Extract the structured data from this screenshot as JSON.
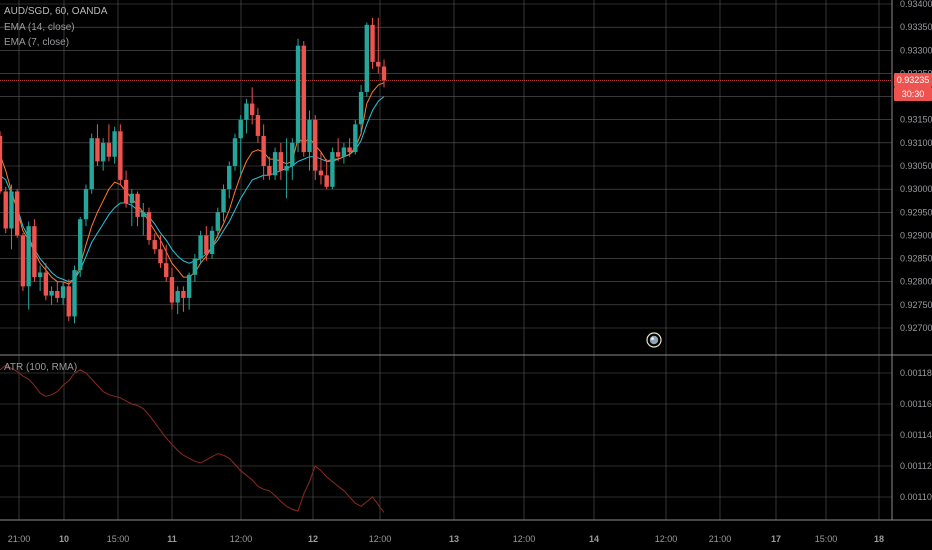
{
  "header": {
    "symbol_line": "AUD/SGD, 60, OANDA",
    "ema14_label": "EMA (14, close)",
    "ema7_label": "EMA (7, close)",
    "atr_label": "ATR (100, RMA)"
  },
  "price_tags": {
    "last_price": "0.93235",
    "countdown": "30:30",
    "last_price_color": "#ef5350"
  },
  "colors": {
    "background": "#000000",
    "grid": "#5a5a5a",
    "up_candle": "#26a69a",
    "down_candle": "#ef5350",
    "ema14": "#26c6da",
    "ema7": "#ff7b2e",
    "atr": "#8b2a20"
  },
  "chart_data": [
    {
      "type": "candlestick",
      "title": "AUD/SGD, 60, OANDA",
      "ylim": [
        0.92665,
        0.93405
      ],
      "y_ticks": [
        "0.93400",
        "0.93350",
        "0.93300",
        "0.93250",
        "0.93200",
        "0.93150",
        "0.93100",
        "0.93050",
        "0.93000",
        "0.92950",
        "0.92900",
        "0.92850",
        "0.92800",
        "0.92750",
        "0.92700"
      ],
      "x_ticks": [
        "21:00",
        "10",
        "15:00",
        "11",
        "12:00",
        "12",
        "12:00",
        "13",
        "12:00",
        "14",
        "12:00",
        "21:00",
        "17",
        "15:00",
        "18"
      ],
      "candles": [
        [
          0.93115,
          0.93125,
          0.9299,
          0.92995
        ],
        [
          0.92995,
          0.93005,
          0.92905,
          0.92915
        ],
        [
          0.92915,
          0.9301,
          0.9287,
          0.92995
        ],
        [
          0.92995,
          0.93,
          0.92895,
          0.929
        ],
        [
          0.929,
          0.92905,
          0.9278,
          0.9279
        ],
        [
          0.9279,
          0.9293,
          0.9274,
          0.9292
        ],
        [
          0.9292,
          0.92935,
          0.928,
          0.9281
        ],
        [
          0.9281,
          0.92835,
          0.9278,
          0.9282
        ],
        [
          0.9282,
          0.9284,
          0.9276,
          0.9277
        ],
        [
          0.9277,
          0.9279,
          0.9275,
          0.9278
        ],
        [
          0.9278,
          0.928,
          0.92755,
          0.92765
        ],
        [
          0.92765,
          0.928,
          0.9275,
          0.9279
        ],
        [
          0.9279,
          0.92805,
          0.92715,
          0.92725
        ],
        [
          0.92725,
          0.92835,
          0.9271,
          0.92825
        ],
        [
          0.92825,
          0.9294,
          0.9281,
          0.92935
        ],
        [
          0.92935,
          0.9301,
          0.9292,
          0.93
        ],
        [
          0.93,
          0.9312,
          0.9299,
          0.9311
        ],
        [
          0.9311,
          0.9314,
          0.9305,
          0.9306
        ],
        [
          0.9306,
          0.9311,
          0.9304,
          0.931
        ],
        [
          0.931,
          0.9314,
          0.9306,
          0.9307
        ],
        [
          0.9307,
          0.93135,
          0.93055,
          0.93125
        ],
        [
          0.93125,
          0.9314,
          0.9301,
          0.9302
        ],
        [
          0.9302,
          0.9304,
          0.9296,
          0.9297
        ],
        [
          0.9297,
          0.93,
          0.9292,
          0.9299
        ],
        [
          0.9299,
          0.92995,
          0.9292,
          0.9294
        ],
        [
          0.9294,
          0.9297,
          0.929,
          0.9295
        ],
        [
          0.9295,
          0.9296,
          0.9288,
          0.9289
        ],
        [
          0.9289,
          0.92905,
          0.9286,
          0.9287
        ],
        [
          0.9287,
          0.929,
          0.9283,
          0.9284
        ],
        [
          0.9284,
          0.9288,
          0.928,
          0.9281
        ],
        [
          0.9281,
          0.9283,
          0.9274,
          0.92755
        ],
        [
          0.92755,
          0.9279,
          0.9273,
          0.9278
        ],
        [
          0.9278,
          0.9279,
          0.92735,
          0.92765
        ],
        [
          0.92765,
          0.9282,
          0.9274,
          0.92815
        ],
        [
          0.92815,
          0.9286,
          0.928,
          0.9285
        ],
        [
          0.9285,
          0.9291,
          0.9284,
          0.929
        ],
        [
          0.929,
          0.9292,
          0.92845,
          0.9286
        ],
        [
          0.9286,
          0.9292,
          0.9285,
          0.9291
        ],
        [
          0.9291,
          0.9296,
          0.92895,
          0.9295
        ],
        [
          0.9295,
          0.9301,
          0.9293,
          0.93
        ],
        [
          0.93,
          0.9306,
          0.9298,
          0.9305
        ],
        [
          0.9305,
          0.9312,
          0.9304,
          0.9311
        ],
        [
          0.9311,
          0.9316,
          0.9303,
          0.9315
        ],
        [
          0.9315,
          0.93195,
          0.9312,
          0.93185
        ],
        [
          0.93185,
          0.9322,
          0.9314,
          0.9316
        ],
        [
          0.9316,
          0.93175,
          0.931,
          0.93115
        ],
        [
          0.93115,
          0.9314,
          0.9302,
          0.9305
        ],
        [
          0.9305,
          0.9307,
          0.9302,
          0.9303
        ],
        [
          0.9303,
          0.9309,
          0.9302,
          0.9308
        ],
        [
          0.9308,
          0.931,
          0.9302,
          0.9304
        ],
        [
          0.9304,
          0.9311,
          0.9298,
          0.9305
        ],
        [
          0.9305,
          0.9311,
          0.9302,
          0.931
        ],
        [
          0.931,
          0.93325,
          0.9308,
          0.9331
        ],
        [
          0.9331,
          0.9332,
          0.9307,
          0.9308
        ],
        [
          0.9308,
          0.9317,
          0.9304,
          0.9315
        ],
        [
          0.9315,
          0.9316,
          0.9302,
          0.9304
        ],
        [
          0.9304,
          0.9308,
          0.9301,
          0.9303
        ],
        [
          0.9303,
          0.93065,
          0.93,
          0.93005
        ],
        [
          0.93005,
          0.9309,
          0.93,
          0.9308
        ],
        [
          0.9308,
          0.9311,
          0.9306,
          0.9307
        ],
        [
          0.9307,
          0.931,
          0.93055,
          0.9309
        ],
        [
          0.9309,
          0.9311,
          0.9307,
          0.9308
        ],
        [
          0.9308,
          0.9315,
          0.93075,
          0.9314
        ],
        [
          0.9314,
          0.93225,
          0.9312,
          0.9321
        ],
        [
          0.9321,
          0.9336,
          0.932,
          0.93355
        ],
        [
          0.93355,
          0.9337,
          0.9326,
          0.93275
        ],
        [
          0.93275,
          0.9337,
          0.9325,
          0.93265
        ],
        [
          0.93265,
          0.9328,
          0.9322,
          0.93235
        ]
      ],
      "ema14": [
        0.9303,
        0.9302,
        0.9299,
        0.9296,
        0.9292,
        0.92895,
        0.9287,
        0.9285,
        0.92835,
        0.9282,
        0.9281,
        0.92805,
        0.928,
        0.92805,
        0.92825,
        0.92855,
        0.92885,
        0.92905,
        0.92925,
        0.92945,
        0.9296,
        0.9297,
        0.9297,
        0.92965,
        0.92955,
        0.9295,
        0.9294,
        0.92925,
        0.92905,
        0.9289,
        0.9287,
        0.92855,
        0.92845,
        0.9284,
        0.92845,
        0.9285,
        0.9286,
        0.92875,
        0.9289,
        0.9291,
        0.9293,
        0.92955,
        0.9298,
        0.93,
        0.9302,
        0.93025,
        0.9303,
        0.9303,
        0.93035,
        0.9304,
        0.93045,
        0.9305,
        0.9306,
        0.93065,
        0.9307,
        0.9307,
        0.93065,
        0.9306,
        0.9306,
        0.93065,
        0.9307,
        0.93075,
        0.93085,
        0.93105,
        0.9314,
        0.9317,
        0.9319,
        0.932
      ],
      "ema7": [
        0.93075,
        0.9304,
        0.92995,
        0.92955,
        0.9291,
        0.9289,
        0.92865,
        0.9284,
        0.92825,
        0.9281,
        0.928,
        0.928,
        0.92795,
        0.92805,
        0.92835,
        0.9288,
        0.9292,
        0.9295,
        0.92975,
        0.93,
        0.93015,
        0.9301,
        0.92995,
        0.9298,
        0.92965,
        0.9295,
        0.9293,
        0.9291,
        0.9289,
        0.92865,
        0.9284,
        0.92825,
        0.9281,
        0.9281,
        0.9282,
        0.9284,
        0.92855,
        0.92875,
        0.929,
        0.92925,
        0.92955,
        0.92995,
        0.9303,
        0.9306,
        0.9308,
        0.93085,
        0.9308,
        0.93065,
        0.93065,
        0.9306,
        0.93055,
        0.9306,
        0.9311,
        0.931,
        0.9311,
        0.93095,
        0.9308,
        0.9306,
        0.93065,
        0.93065,
        0.9307,
        0.93075,
        0.9309,
        0.9312,
        0.93185,
        0.9321,
        0.93225,
        0.9323
      ]
    },
    {
      "type": "line",
      "title": "ATR (100, RMA)",
      "ylim": [
        0.001085,
        0.001195
      ],
      "y_ticks": [
        "0.00118",
        "0.00116",
        "0.00114",
        "0.00112",
        "0.00110"
      ],
      "series": [
        {
          "name": "ATR (100, RMA)",
          "values": [
            0.001182,
            0.001185,
            0.001183,
            0.001181,
            0.001178,
            0.001176,
            0.001172,
            0.001167,
            0.001165,
            0.001166,
            0.001168,
            0.001172,
            0.001175,
            0.00118,
            0.001182,
            0.00118,
            0.001176,
            0.001172,
            0.001168,
            0.001166,
            0.001165,
            0.001164,
            0.001162,
            0.00116,
            0.001159,
            0.001157,
            0.001153,
            0.001148,
            0.001143,
            0.001138,
            0.001134,
            0.00113,
            0.001127,
            0.001125,
            0.001123,
            0.001122,
            0.001124,
            0.001126,
            0.001128,
            0.001127,
            0.001125,
            0.001121,
            0.001117,
            0.001114,
            0.001111,
            0.001107,
            0.001105,
            0.001104,
            0.001101,
            0.001097,
            0.001094,
            0.001092,
            0.001091,
            0.001102,
            0.00111,
            0.00112,
            0.001117,
            0.001113,
            0.00111,
            0.001107,
            0.001104,
            0.0011,
            0.001096,
            0.001094,
            0.001097,
            0.0011,
            0.001095,
            0.00109
          ]
        }
      ]
    }
  ]
}
